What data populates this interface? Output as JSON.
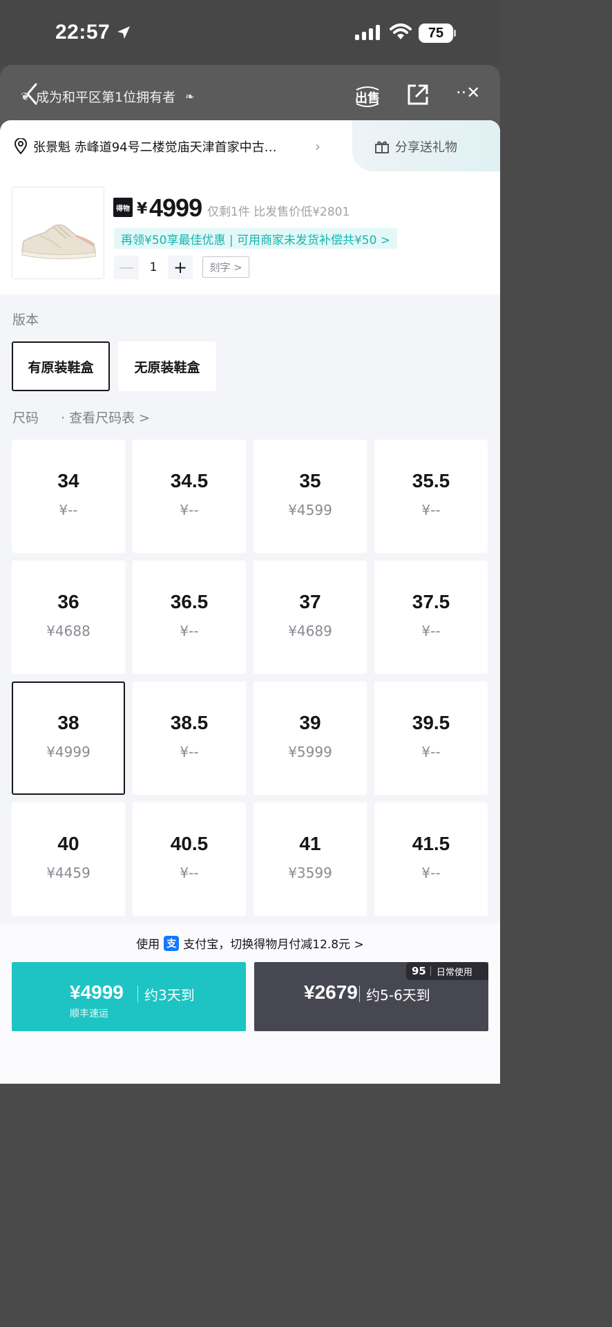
{
  "status_bar": {
    "time": "22:57",
    "battery": "75"
  },
  "header": {
    "title": "成为和平区第1位拥有者",
    "sell_label": "出售",
    "close_symbol": "··✕"
  },
  "address": {
    "text": "张景魁  赤峰道94号二楼觉庙天津首家中古…",
    "gift_label": "分享送礼物"
  },
  "product": {
    "badge": "得物",
    "currency": "¥",
    "price": "4999",
    "note": "仅剩1件  比发售价低¥2801",
    "coupon": "再领¥50享最佳优惠 | 可用商家未发货补偿共¥50 >",
    "quantity": "1",
    "minus": "—",
    "plus": "+",
    "engrave_label": "刻字 >"
  },
  "version": {
    "label": "版本",
    "options": [
      "有原装鞋盒",
      "无原装鞋盒"
    ],
    "selected": 0
  },
  "size": {
    "label": "尺码",
    "link": "· 查看尺码表 >",
    "selected_index": 8,
    "cells": [
      {
        "size": "34",
        "price": "¥--"
      },
      {
        "size": "34.5",
        "price": "¥--"
      },
      {
        "size": "35",
        "price": "¥4599"
      },
      {
        "size": "35.5",
        "price": "¥--"
      },
      {
        "size": "36",
        "price": "¥4688"
      },
      {
        "size": "36.5",
        "price": "¥--"
      },
      {
        "size": "37",
        "price": "¥4689"
      },
      {
        "size": "37.5",
        "price": "¥--"
      },
      {
        "size": "38",
        "price": "¥4999"
      },
      {
        "size": "38.5",
        "price": "¥--"
      },
      {
        "size": "39",
        "price": "¥5999"
      },
      {
        "size": "39.5",
        "price": "¥--"
      },
      {
        "size": "40",
        "price": "¥4459"
      },
      {
        "size": "40.5",
        "price": "¥--"
      },
      {
        "size": "41",
        "price": "¥3599"
      },
      {
        "size": "41.5",
        "price": "¥--"
      }
    ]
  },
  "payment": {
    "prefix": "使用",
    "alipay_icon": "支",
    "text": "支付宝，切换得物月付减12.8元 >"
  },
  "buttons": {
    "fast": {
      "price": "¥4999",
      "eta": "约3天到",
      "sub": "顺丰速运"
    },
    "slow": {
      "price": "¥2679",
      "eta": "约5-6天到"
    },
    "badge_95": "95",
    "badge_text": "日常使用"
  },
  "colors": {
    "accent": "#1ec3c3",
    "dark_button": "#474752",
    "coupon_text": "#13b5b1"
  }
}
